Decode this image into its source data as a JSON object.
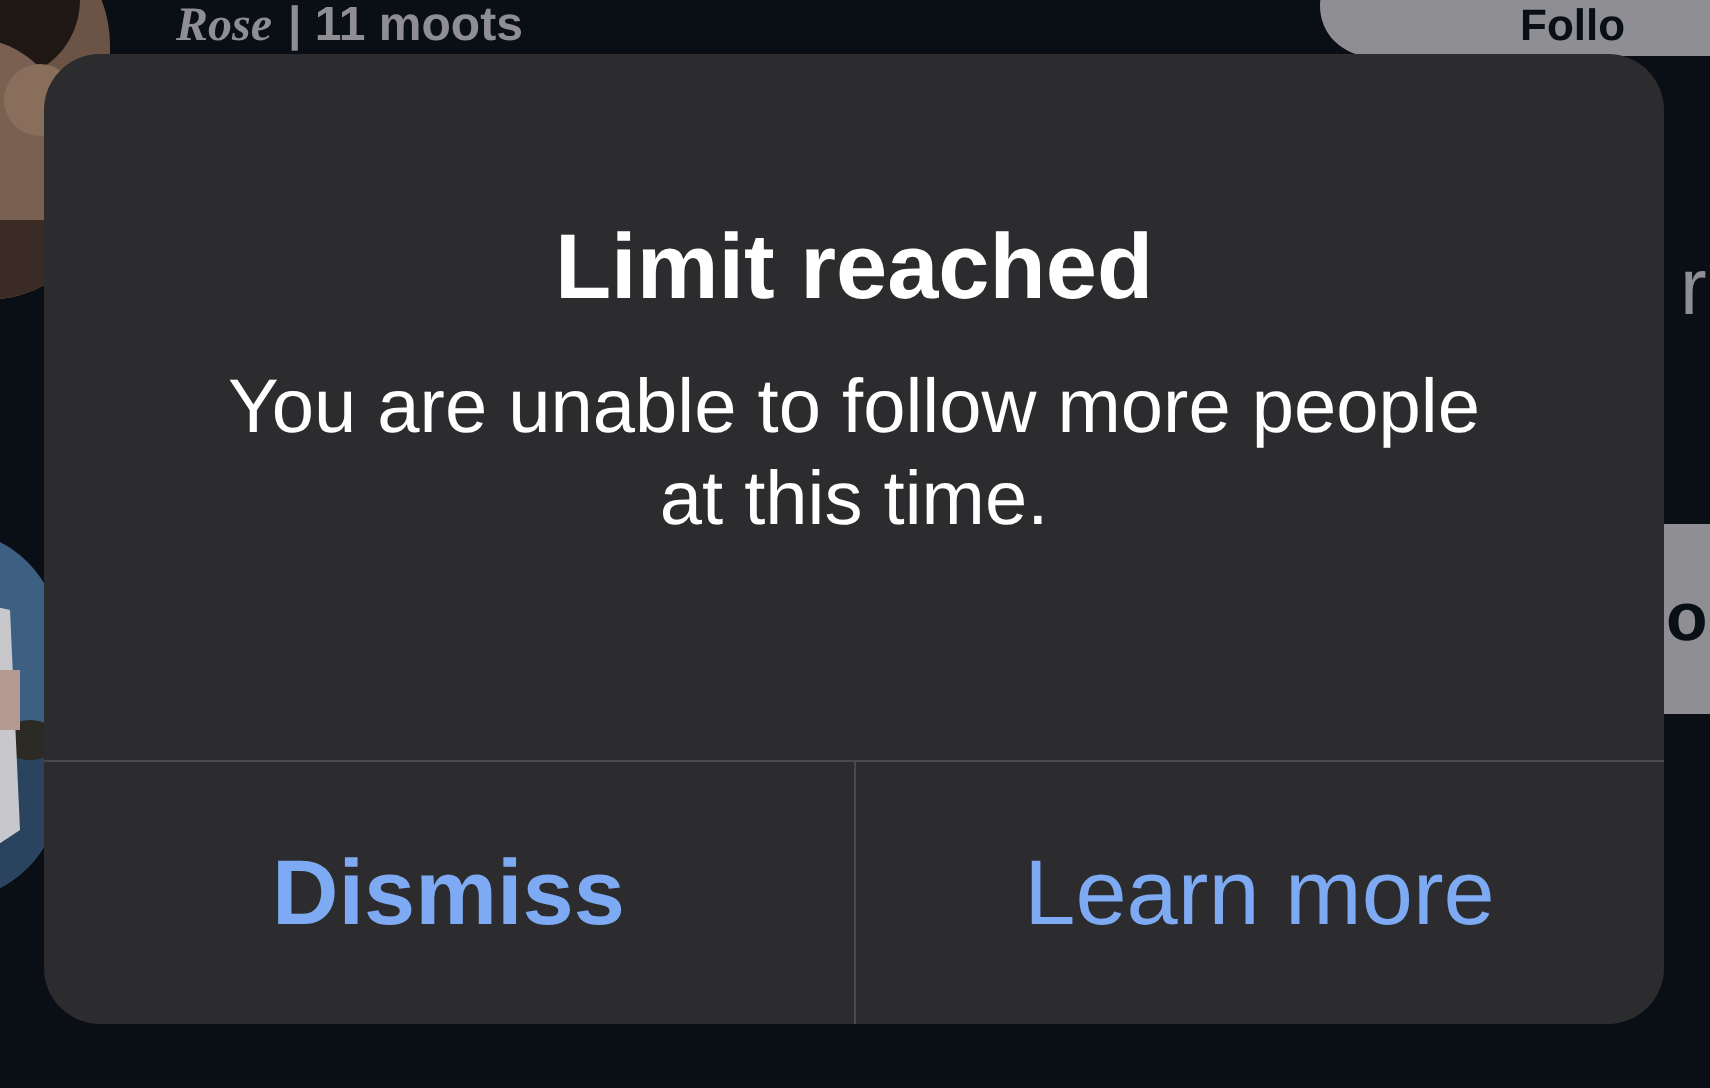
{
  "background": {
    "profile_name": "Rose",
    "profile_meta": "| 11 moots",
    "follow_button": "Follo",
    "side_text": "r",
    "side_button": "o"
  },
  "alert": {
    "title": "Limit reached",
    "message": "You are unable to follow more people at this time.",
    "buttons": [
      {
        "label": "Dismiss",
        "kind": "default"
      },
      {
        "label": "Learn more",
        "kind": "normal"
      }
    ]
  }
}
